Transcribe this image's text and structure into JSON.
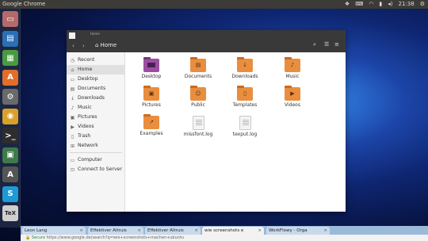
{
  "panel": {
    "app_title": "Google Chrome",
    "time": "21:38"
  },
  "launcher": {
    "items": [
      {
        "name": "files-launcher",
        "color": "#b56a6a",
        "glyph": "▭"
      },
      {
        "name": "writer-launcher",
        "color": "#2b6fb4",
        "glyph": "▤"
      },
      {
        "name": "calc-launcher",
        "color": "#4a9a40",
        "glyph": "▦"
      },
      {
        "name": "software-center-launcher",
        "color": "#e36d2a",
        "glyph": "A"
      },
      {
        "name": "settings-launcher",
        "color": "#6a6a6a",
        "glyph": "⚙"
      },
      {
        "name": "chrome-launcher",
        "color": "#d9a02a",
        "glyph": "◉"
      },
      {
        "name": "terminal-launcher",
        "color": "#2d2d2d",
        "glyph": ">_"
      },
      {
        "name": "image-viewer-launcher",
        "color": "#3f7a4a",
        "glyph": "▣"
      },
      {
        "name": "inkscape-launcher",
        "color": "#555",
        "glyph": "A"
      },
      {
        "name": "skype-launcher",
        "color": "#1e9ad6",
        "glyph": "S"
      },
      {
        "name": "texmaker-launcher",
        "color": "#cfcfcf",
        "glyph": "TeX"
      }
    ]
  },
  "window": {
    "small_title": "Home",
    "breadcrumb": "Home"
  },
  "sidebar": {
    "items": [
      {
        "label": "Recent",
        "icon": "clock-icon",
        "glyph": "◷"
      },
      {
        "label": "Home",
        "icon": "home-icon",
        "glyph": "⌂"
      },
      {
        "label": "Desktop",
        "icon": "desktop-icon",
        "glyph": "▭"
      },
      {
        "label": "Documents",
        "icon": "document-icon",
        "glyph": "▤"
      },
      {
        "label": "Downloads",
        "icon": "download-icon",
        "glyph": "↓"
      },
      {
        "label": "Music",
        "icon": "music-icon",
        "glyph": "♪"
      },
      {
        "label": "Pictures",
        "icon": "picture-icon",
        "glyph": "▣"
      },
      {
        "label": "Videos",
        "icon": "video-icon",
        "glyph": "▶"
      },
      {
        "label": "Trash",
        "icon": "trash-icon",
        "glyph": "▯"
      },
      {
        "label": "Network",
        "icon": "network-icon",
        "glyph": "⊞"
      },
      {
        "label": "Computer",
        "icon": "computer-icon",
        "glyph": "▭"
      },
      {
        "label": "Connect to Server",
        "icon": "server-icon",
        "glyph": "⊡"
      }
    ]
  },
  "files": [
    {
      "label": "Desktop",
      "kind": "folder-purple",
      "emblem": ""
    },
    {
      "label": "Documents",
      "kind": "folder",
      "emblem": "▤"
    },
    {
      "label": "Downloads",
      "kind": "folder",
      "emblem": "↓"
    },
    {
      "label": "Music",
      "kind": "folder",
      "emblem": "♪"
    },
    {
      "label": "Pictures",
      "kind": "folder",
      "emblem": "▣"
    },
    {
      "label": "Public",
      "kind": "folder",
      "emblem": "☺"
    },
    {
      "label": "Templates",
      "kind": "folder",
      "emblem": "▯"
    },
    {
      "label": "Videos",
      "kind": "folder",
      "emblem": "▶"
    },
    {
      "label": "Examples",
      "kind": "folder",
      "emblem": "↗"
    },
    {
      "label": "missfont.log",
      "kind": "doc",
      "emblem": ""
    },
    {
      "label": "texput.log",
      "kind": "doc",
      "emblem": ""
    }
  ],
  "chrome": {
    "tabs": [
      {
        "label": "Leon Lang",
        "active": false
      },
      {
        "label": "Effektiver Altruis",
        "active": false
      },
      {
        "label": "Effektiver Altruis",
        "active": false
      },
      {
        "label": "wie screenshots e",
        "active": true
      },
      {
        "label": "WorkFlowy - Orga",
        "active": false
      }
    ],
    "secure_label": "Secure",
    "url": "https://www.google.de/search?q=wie+screenshots+machen+ubuntu"
  }
}
